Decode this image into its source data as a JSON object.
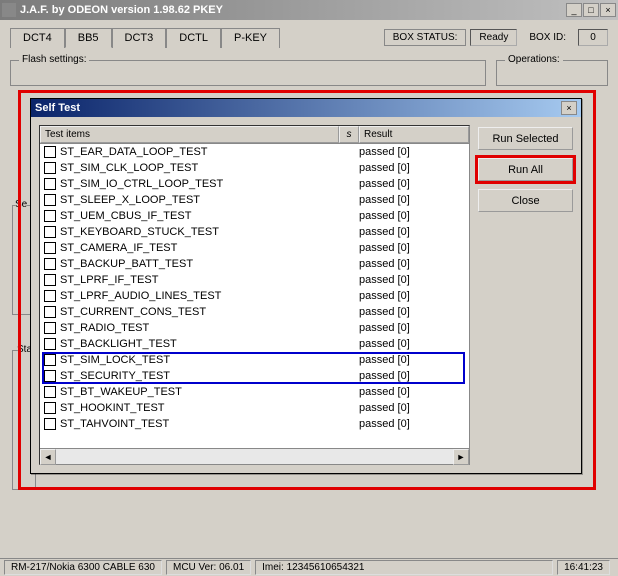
{
  "window": {
    "title": "J.A.F. by ODEON version 1.98.62 PKEY",
    "min": "_",
    "max": "□",
    "close": "×"
  },
  "tabs": [
    {
      "label": "DCT4",
      "active": false
    },
    {
      "label": "BB5",
      "active": true
    },
    {
      "label": "DCT3",
      "active": false
    },
    {
      "label": "DCTL",
      "active": false
    },
    {
      "label": "P-KEY",
      "active": false
    }
  ],
  "boxstatus_label": "BOX STATUS:",
  "boxstatus_value": "Ready",
  "boxid_label": "BOX ID:",
  "boxid_value": "0",
  "flash_label": "Flash settings:",
  "ops_label": "Operations:",
  "status_group_label": "Statu",
  "dialog": {
    "title": "Self Test",
    "close": "×",
    "col_test": "Test items",
    "col_s": "s",
    "col_result": "Result",
    "btn_run_selected": "Run Selected",
    "btn_run_all": "Run All",
    "btn_close": "Close",
    "result_text": "passed [0]",
    "items": [
      "ST_EAR_DATA_LOOP_TEST",
      "ST_SIM_CLK_LOOP_TEST",
      "ST_SIM_IO_CTRL_LOOP_TEST",
      "ST_SLEEP_X_LOOP_TEST",
      "ST_UEM_CBUS_IF_TEST",
      "ST_KEYBOARD_STUCK_TEST",
      "ST_CAMERA_IF_TEST",
      "ST_BACKUP_BATT_TEST",
      "ST_LPRF_IF_TEST",
      "ST_LPRF_AUDIO_LINES_TEST",
      "ST_CURRENT_CONS_TEST",
      "ST_RADIO_TEST",
      "ST_BACKLIGHT_TEST",
      "ST_SIM_LOCK_TEST",
      "ST_SECURITY_TEST",
      "ST_BT_WAKEUP_TEST",
      "ST_HOOKINT_TEST",
      "ST_TAHVOINT_TEST"
    ],
    "highlight_start": 13,
    "highlight_end": 14
  },
  "statusbar": {
    "model": "RM-217/Nokia 6300 CABLE 630",
    "mcu": "MCU Ver: 06.01",
    "imei": "Imei: 12345610654321",
    "time": "16:41:23"
  }
}
